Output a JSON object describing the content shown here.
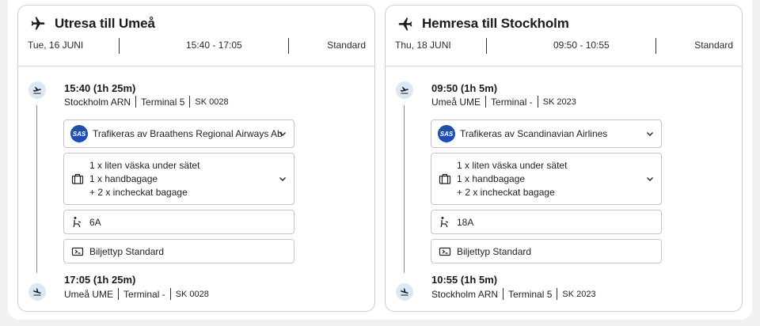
{
  "outbound": {
    "title": "Utresa till Umeå",
    "date": "Tue, 16 JUNI",
    "time_range": "15:40 - 17:05",
    "fare_class": "Standard",
    "departure": {
      "time": "15:40",
      "duration": "(1h 25m)",
      "airport": "Stockholm ARN",
      "terminal": "Terminal 5",
      "flight": "SK 0028"
    },
    "operator": "Trafikeras av Braathens Regional Airways Ab",
    "baggage": [
      "1 x liten väska under sätet",
      "1 x handbagage",
      "+ 2 x incheckat bagage"
    ],
    "seat": "6A",
    "ticket_type": "Biljettyp Standard",
    "arrival": {
      "time": "17:05",
      "duration": "(1h 25m)",
      "airport": "Umeå UME",
      "terminal": "Terminal -",
      "flight": "SK 0028"
    }
  },
  "return": {
    "title": "Hemresa till Stockholm",
    "date": "Thu, 18 JUNI",
    "time_range": "09:50 - 10:55",
    "fare_class": "Standard",
    "departure": {
      "time": "09:50",
      "duration": "(1h 5m)",
      "airport": "Umeå UME",
      "terminal": "Terminal -",
      "flight": "SK 2023"
    },
    "operator": "Trafikeras av Scandinavian Airlines",
    "baggage": [
      "1 x liten väska under sätet",
      "1 x handbagage",
      "+ 2 x incheckat bagage"
    ],
    "seat": "18A",
    "ticket_type": "Biljettyp Standard",
    "arrival": {
      "time": "10:55",
      "duration": "(1h 5m)",
      "airport": "Stockholm ARN",
      "terminal": "Terminal 5",
      "flight": "SK 2023"
    }
  },
  "airline_logo_text": "SAS",
  "icons": {
    "title_plane": "airplane-icon",
    "takeoff": "takeoff-icon",
    "landing": "landing-icon",
    "baggage": "briefcase-icon",
    "seat": "seat-icon",
    "ticket": "ticket-icon",
    "expand": "chevron-down-icon"
  },
  "colors": {
    "segment_icon_bg": "#dbe8f3",
    "sas_blue": "#1f4fa8",
    "border": "#c6c6c6"
  }
}
